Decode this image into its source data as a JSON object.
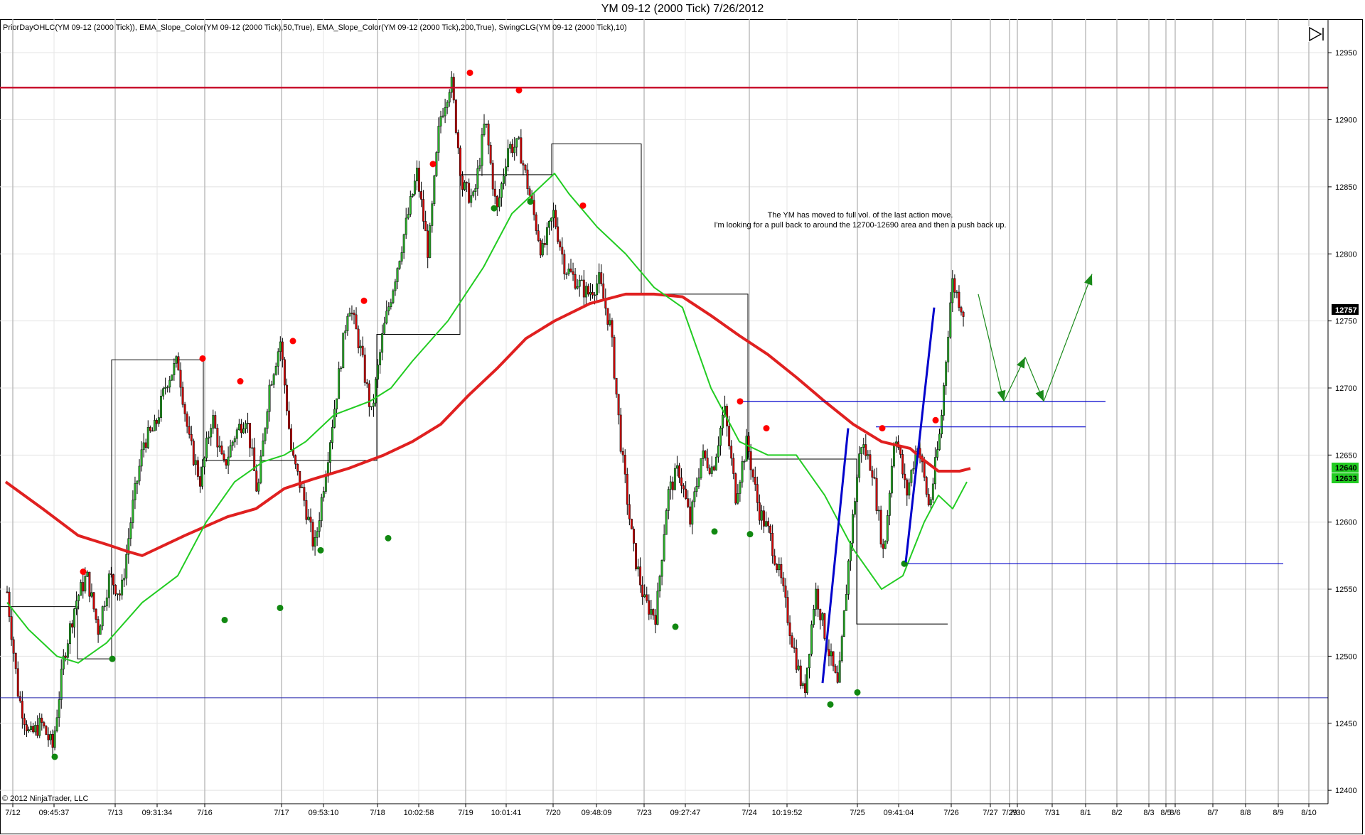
{
  "window": {
    "title": "YM 09-12 (2000 Tick)  7/26/2012"
  },
  "indicators_label": "PriorDayOHLC(YM 09-12 (2000 Tick)), EMA_Slope_Color(YM 09-12 (2000 Tick),50,True), EMA_Slope_Color(YM 09-12 (2000 Tick),200,True), SwingCLG(YM 09-12 (2000 Tick),10)",
  "copyright": "© 2012 NinjaTrader, LLC",
  "annotation": {
    "line1": "The YM has moved to full vol. of the last action move.",
    "line2": "I'm looking for a pull back to around the 12700-12690 area and then a push back up."
  },
  "price_tags": {
    "last": "12757",
    "ema_upper": "12640",
    "ema_lower": "12633"
  },
  "colors": {
    "up": "#2bb52b",
    "down": "#d40000",
    "ema200": "#e02020",
    "ema50": "#22cc22",
    "blue": "#0000cc",
    "swing_high": "#ff0000",
    "swing_low": "#118811",
    "arrow": "#1a8a1a",
    "resistance": "#c8102e"
  },
  "chart_data": {
    "type": "candlestick",
    "title": "YM 09-12 (2000 Tick)  7/26/2012",
    "ylim": [
      12390,
      12975
    ],
    "y_ticks": [
      12400,
      12450,
      12500,
      12550,
      12600,
      12650,
      12700,
      12750,
      12800,
      12850,
      12900,
      12950
    ],
    "x_labels": [
      "7/12",
      "09:45:37",
      "7/13",
      "09:31:34",
      "7/16",
      "7/17",
      "09:53:10",
      "7/18",
      "10:02:58",
      "7/19",
      "10:01:41",
      "7/20",
      "09:48:09",
      "7/23",
      "09:27:47",
      "7/24",
      "10:19:52",
      "7/25",
      "09:41:04",
      "7/26",
      "7/27",
      "7/29",
      "7/30",
      "7/31",
      "8/1",
      "8/2",
      "8/3",
      "8/5",
      "8/6",
      "8/7",
      "8/8",
      "8/9",
      "8/10"
    ],
    "close_path": [
      12548,
      12470,
      12440,
      12450,
      12432,
      12500,
      12540,
      12560,
      12520,
      12560,
      12545,
      12610,
      12660,
      12670,
      12705,
      12720,
      12660,
      12630,
      12680,
      12640,
      12665,
      12680,
      12620,
      12700,
      12735,
      12650,
      12620,
      12580,
      12640,
      12700,
      12765,
      12730,
      12680,
      12740,
      12780,
      12820,
      12860,
      12800,
      12900,
      12930,
      12850,
      12840,
      12900,
      12830,
      12880,
      12880,
      12840,
      12800,
      12830,
      12790,
      12780,
      12770,
      12780,
      12745,
      12650,
      12580,
      12540,
      12530,
      12620,
      12640,
      12600,
      12650,
      12640,
      12685,
      12620,
      12660,
      12610,
      12590,
      12555,
      12510,
      12470,
      12550,
      12510,
      12475,
      12580,
      12660,
      12640,
      12575,
      12670,
      12620,
      12660,
      12610,
      12670,
      12780,
      12757
    ],
    "ema200": [
      12630,
      12610,
      12590,
      12583,
      12578,
      12575,
      12590,
      12604,
      12610,
      12625,
      12632,
      12640,
      12650,
      12660,
      12673,
      12695,
      12715,
      12737,
      12750,
      12763,
      12770,
      12770,
      12768,
      12754,
      12739,
      12725,
      12708,
      12690,
      12673,
      12660,
      12655,
      12646,
      12638,
      12638,
      12640
    ],
    "ema200_x": [
      8,
      60,
      110,
      152,
      180,
      200,
      260,
      320,
      360,
      400,
      440,
      490,
      540,
      580,
      620,
      660,
      700,
      740,
      780,
      830,
      880,
      920,
      960,
      1000,
      1040,
      1080,
      1120,
      1160,
      1200,
      1240,
      1280,
      1300,
      1320,
      1350,
      1365
    ],
    "ema50": [
      12540,
      12520,
      12500,
      12495,
      12510,
      12540,
      12560,
      12600,
      12630,
      12645,
      12650,
      12660,
      12680,
      12690,
      12700,
      12720,
      12750,
      12790,
      12830,
      12850,
      12860,
      12845,
      12820,
      12800,
      12775,
      12760,
      12700,
      12660,
      12650,
      12650,
      12620,
      12580,
      12550,
      12560,
      12600,
      12620,
      12610,
      12630
    ],
    "ema50_x": [
      10,
      40,
      80,
      110,
      150,
      200,
      250,
      290,
      330,
      370,
      400,
      430,
      470,
      520,
      550,
      580,
      630,
      680,
      720,
      760,
      780,
      800,
      840,
      880,
      920,
      960,
      1000,
      1040,
      1080,
      1120,
      1160,
      1200,
      1240,
      1270,
      1300,
      1320,
      1340,
      1360
    ],
    "resistance_level": 12924,
    "support_level": 12469,
    "blue_levels": [
      {
        "y": 12690,
        "x1": 1043,
        "x2": 1555
      },
      {
        "y": 12671,
        "x1": 1232,
        "x2": 1527
      },
      {
        "y": 12569,
        "x1": 1272,
        "x2": 1805
      }
    ],
    "prior_day_hl": [
      [
        0,
        109,
        12537
      ],
      [
        109,
        157,
        12498
      ],
      [
        157,
        286,
        12721
      ],
      [
        286,
        393,
        12646
      ],
      [
        393,
        530,
        12646
      ],
      [
        530,
        647,
        12740
      ],
      [
        647,
        776,
        12859
      ],
      [
        776,
        902,
        12882
      ],
      [
        902,
        1052,
        12770
      ],
      [
        1052,
        1205,
        12647
      ],
      [
        1205,
        1333,
        12524
      ]
    ],
    "swing_highs": [
      [
        117,
        12563
      ],
      [
        285,
        12722
      ],
      [
        338,
        12705
      ],
      [
        412,
        12735
      ],
      [
        512,
        12765
      ],
      [
        609,
        12867
      ],
      [
        661,
        12935
      ],
      [
        730,
        12922
      ],
      [
        820,
        12836
      ],
      [
        1041,
        12690
      ],
      [
        1078,
        12670
      ],
      [
        1241,
        12670
      ],
      [
        1316,
        12676
      ]
    ],
    "swing_lows": [
      [
        77,
        12425
      ],
      [
        158,
        12498
      ],
      [
        316,
        12527
      ],
      [
        394,
        12536
      ],
      [
        451,
        12579
      ],
      [
        546,
        12588
      ],
      [
        695,
        12834
      ],
      [
        746,
        12839
      ],
      [
        950,
        12522
      ],
      [
        1005,
        12593
      ],
      [
        1055,
        12591
      ],
      [
        1168,
        12464
      ],
      [
        1206,
        12473
      ],
      [
        1272,
        12569
      ]
    ],
    "blue_lines": [
      [
        1157,
        12480,
        1193,
        12670
      ],
      [
        1274,
        12570,
        1314,
        12760
      ]
    ],
    "arrow_path": [
      [
        1376,
        12770
      ],
      [
        1412,
        12690
      ],
      [
        1442,
        12723
      ],
      [
        1468,
        12690
      ],
      [
        1536,
        12785
      ]
    ]
  }
}
